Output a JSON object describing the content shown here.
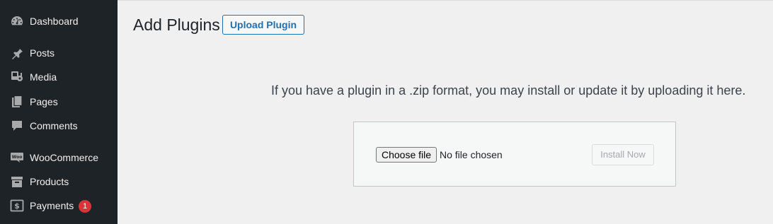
{
  "sidebar": {
    "items": [
      {
        "label": "Dashboard",
        "icon": "dashboard-icon"
      },
      {
        "label": "Posts",
        "icon": "pin-icon"
      },
      {
        "label": "Media",
        "icon": "media-icon"
      },
      {
        "label": "Pages",
        "icon": "pages-icon"
      },
      {
        "label": "Comments",
        "icon": "comment-icon"
      },
      {
        "label": "WooCommerce",
        "icon": "woocommerce-icon"
      },
      {
        "label": "Products",
        "icon": "archive-icon"
      },
      {
        "label": "Payments",
        "icon": "payments-icon",
        "badge": "1"
      }
    ],
    "woo_icon_text": "Woo"
  },
  "page": {
    "title": "Add Plugins",
    "upload_button": "Upload Plugin"
  },
  "upload": {
    "help_text": "If you have a plugin in a .zip format, you may install or update it by uploading it here.",
    "choose_button": "Choose file",
    "file_status": "No file chosen",
    "install_button": "Install Now"
  },
  "colors": {
    "sidebar_bg": "#1d2327",
    "accent": "#2271b1",
    "badge": "#d63638",
    "content_bg": "#f0f0f1"
  }
}
